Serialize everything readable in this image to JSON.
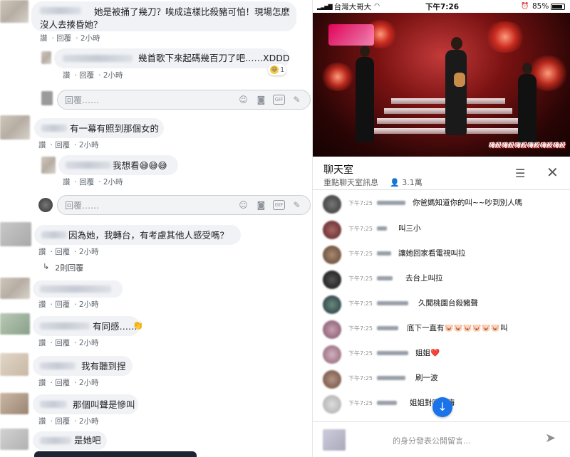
{
  "facebook": {
    "reply_placeholder": "回覆……",
    "comments": [
      {
        "text": "她是被捅了幾刀？唉成這樣比殺豬可怕！現場怎麼沒人去揍昏她？",
        "line1": "她是被捅了幾刀？唉成這樣比殺豬可怕！現場怎麼",
        "line2": "沒人去揍昏她？",
        "like": "讚",
        "reply": "回覆",
        "time": "2小時"
      },
      {
        "text": "幾首歌下來起碼幾百刀了吧……XDDD",
        "like": "讚",
        "reply": "回覆",
        "time": "2小時",
        "reaction_count": "1",
        "reaction_icon": "laugh-emoji"
      },
      {
        "text": "有一幕有照到那個女的",
        "like": "讚",
        "reply": "回覆",
        "time": "2小時"
      },
      {
        "text": "我想看😅😅😅",
        "like": "讚",
        "reply": "回覆",
        "time": "2小時"
      },
      {
        "text": "因為她，我轉台，有考慮其他人感受嗎？",
        "like": "讚",
        "reply": "回覆",
        "time": "2小時",
        "replies_link": "2則回覆"
      },
      {
        "text": "",
        "like": "讚",
        "reply": "回覆",
        "time": "2小時"
      },
      {
        "text": "有同感……",
        "like": "讚",
        "reply": "回覆",
        "time": "2小時"
      },
      {
        "text": "我有聽到捏",
        "like": "讚",
        "reply": "回覆",
        "time": "2小時"
      },
      {
        "text": "那個叫聲是慘叫",
        "like": "讚",
        "reply": "回覆",
        "time": "2小時"
      },
      {
        "text": "是她吧",
        "like": "",
        "reply": "",
        "time": ""
      }
    ]
  },
  "phone": {
    "status": {
      "carrier": "台灣大哥大",
      "time": "下午7:26",
      "battery": "85%"
    },
    "video": {
      "caption": "嗨殺嗨殺嗨殺嗨殺嗨殺嗨殺"
    },
    "chat": {
      "title": "聊天室",
      "subtitle": "重點聊天室訊息",
      "viewers": "3.1萬",
      "messages": [
        {
          "time": "下午7:25",
          "text": "你爸媽知道你的叫~~吵到別人嗎"
        },
        {
          "time": "下午7:25",
          "text": "叫三小"
        },
        {
          "time": "下午7:25",
          "text": "讓她回家看電視叫拉"
        },
        {
          "time": "下午7:25",
          "text": "去台上叫拉"
        },
        {
          "time": "下午7:25",
          "text": "久聞桃園台殺豬聲"
        },
        {
          "time": "下午7:25",
          "text": "底下一直有🐷🐷🐷🐷🐷🐷叫"
        },
        {
          "time": "下午7:25",
          "text": "姐姐❤️"
        },
        {
          "time": "下午7:25",
          "text": "刷一波"
        },
        {
          "time": "下午7:25",
          "text": "姐姐對嗨嗨嗨"
        }
      ],
      "input_placeholder": "的身分發表公開留言..."
    }
  },
  "colors": {
    "fb_bubble": "#f0f2f5",
    "fb_link": "#4b4f56",
    "scroll_button": "#1a73e8"
  }
}
